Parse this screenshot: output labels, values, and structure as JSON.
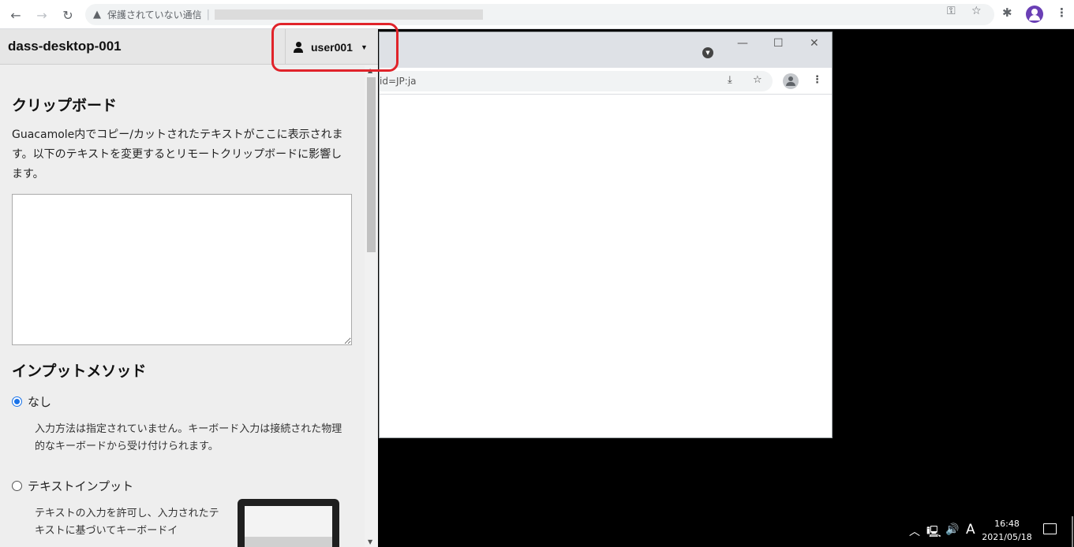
{
  "browser": {
    "security_label": "保護されていない通信",
    "separator": "|"
  },
  "menu": {
    "title": "dass-desktop-001",
    "user": "user001"
  },
  "clipboard": {
    "heading": "クリップボード",
    "description": "Guacamole内でコピー/カットされたテキストがここに表示されます。以下のテキストを変更するとリモートクリップボードに影響します。",
    "value": ""
  },
  "input_method": {
    "heading": "インプットメソッド",
    "options": [
      {
        "label": "なし",
        "selected": true,
        "description": "入力方法は指定されていません。キーボード入力は接続された物理的なキーボードから受け付けられます。"
      },
      {
        "label": "テキストインプット",
        "selected": false,
        "description": "テキストの入力を許可し、入力されたテキストに基づいてキーボードイ"
      }
    ]
  },
  "remote_window": {
    "url_fragment": "id=JP:ja"
  },
  "taskbar": {
    "ime_indicator": "A",
    "time": "16:48",
    "date": "2021/05/18"
  },
  "colors": {
    "highlight": "#e0232a",
    "radio_accent": "#1a73e8"
  }
}
